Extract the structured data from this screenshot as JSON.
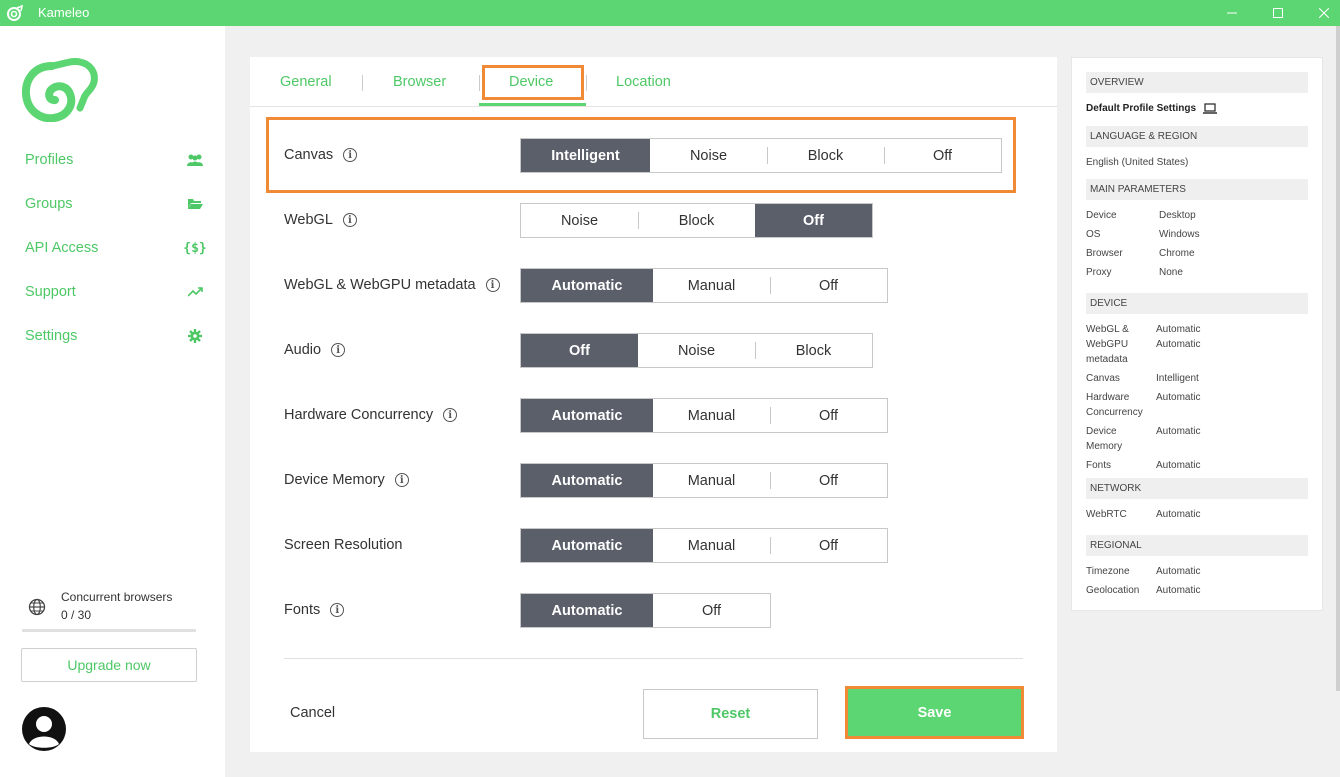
{
  "window": {
    "title": "Kameleo"
  },
  "colors": {
    "brand_green": "#5bd672",
    "selected_segment": "#5a5f6a",
    "highlight_orange": "#f08a36"
  },
  "sidebar": {
    "items": [
      {
        "label": "Profiles",
        "icon": "users-icon"
      },
      {
        "label": "Groups",
        "icon": "folder-icon"
      },
      {
        "label": "API Access",
        "icon": "code-braces-icon"
      },
      {
        "label": "Support",
        "icon": "trend-icon"
      },
      {
        "label": "Settings",
        "icon": "gear-icon"
      }
    ],
    "concurrent_label": "Concurrent browsers",
    "concurrent_value": "0 / 30",
    "concurrent_fraction": 0,
    "upgrade_label": "Upgrade now"
  },
  "tabs": [
    {
      "label": "General"
    },
    {
      "label": "Browser"
    },
    {
      "label": "Device",
      "active": true
    },
    {
      "label": "Location"
    }
  ],
  "settings": [
    {
      "label": "Canvas",
      "options": [
        "Intelligent",
        "Noise",
        "Block",
        "Off"
      ],
      "selected": "Intelligent"
    },
    {
      "label": "WebGL",
      "options": [
        "Noise",
        "Block",
        "Off"
      ],
      "selected": "Off"
    },
    {
      "label": "WebGL & WebGPU metadata",
      "options": [
        "Automatic",
        "Manual",
        "Off"
      ],
      "selected": "Automatic"
    },
    {
      "label": "Audio",
      "options": [
        "Off",
        "Noise",
        "Block"
      ],
      "selected": "Off"
    },
    {
      "label": "Hardware Concurrency",
      "options": [
        "Automatic",
        "Manual",
        "Off"
      ],
      "selected": "Automatic"
    },
    {
      "label": "Device Memory",
      "options": [
        "Automatic",
        "Manual",
        "Off"
      ],
      "selected": "Automatic"
    },
    {
      "label": "Screen Resolution",
      "options": [
        "Automatic",
        "Manual",
        "Off"
      ],
      "selected": "Automatic"
    },
    {
      "label": "Fonts",
      "options": [
        "Automatic",
        "Off"
      ],
      "selected": "Automatic"
    }
  ],
  "footer": {
    "cancel_label": "Cancel",
    "reset_label": "Reset",
    "save_label": "Save"
  },
  "overview": {
    "heading": "OVERVIEW",
    "title": "Default Profile Settings",
    "lang_heading": "LANGUAGE & REGION",
    "lang_value": "English (United States)",
    "main_heading": "MAIN PARAMETERS",
    "main_params": [
      {
        "key": "Device",
        "value": "Desktop"
      },
      {
        "key": "OS",
        "value": "Windows"
      },
      {
        "key": "Browser",
        "value": "Chrome"
      },
      {
        "key": "Proxy",
        "value": "None"
      }
    ],
    "device_heading": "DEVICE",
    "device_params": [
      {
        "key": "WebGL & WebGPU metadata",
        "value": "Automatic Automatic"
      },
      {
        "key": "Canvas",
        "value": "Intelligent"
      },
      {
        "key": "Hardware Concurrency",
        "value": "Automatic"
      },
      {
        "key": "Device Memory",
        "value": "Automatic"
      },
      {
        "key": "Fonts",
        "value": "Automatic"
      }
    ],
    "network_heading": "NETWORK",
    "network_params": [
      {
        "key": "WebRTC",
        "value": "Automatic"
      }
    ],
    "regional_heading": "REGIONAL",
    "regional_params": [
      {
        "key": "Timezone",
        "value": "Automatic"
      },
      {
        "key": "Geolocation",
        "value": "Automatic"
      }
    ]
  }
}
